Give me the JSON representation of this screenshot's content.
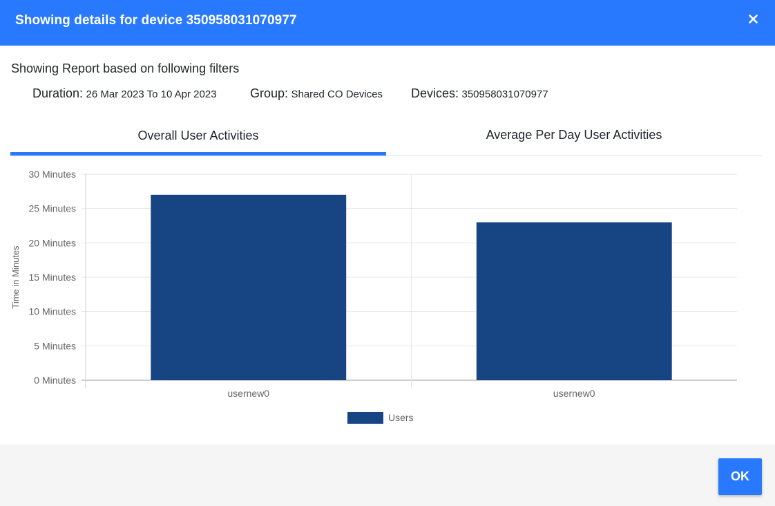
{
  "dialog": {
    "title": "Showing details for device 350958031070977",
    "close_icon": "close-icon"
  },
  "filters": {
    "heading": "Showing Report based on following filters",
    "duration_label": "Duration:",
    "duration_value": "26 Mar 2023 To 10 Apr 2023",
    "group_label": "Group:",
    "group_value": "Shared CO Devices",
    "devices_label": "Devices:",
    "devices_value": "350958031070977"
  },
  "tabs": [
    {
      "label": "Overall User Activities",
      "active": true
    },
    {
      "label": "Average Per Day User Activities",
      "active": false
    }
  ],
  "colors": {
    "accent": "#2979ff",
    "bar": "#174584"
  },
  "chart_data": {
    "type": "bar",
    "categories": [
      "usernew0",
      "usernew0"
    ],
    "series": [
      {
        "name": "Users",
        "values": [
          27,
          23
        ],
        "color": "#174584"
      }
    ],
    "ylabel": "Time in Minutes",
    "ylim": [
      0,
      30
    ],
    "yticks": [
      0,
      5,
      10,
      15,
      20,
      25,
      30
    ],
    "ytick_suffix": " Minutes",
    "grid": true,
    "legend": "bottom-center"
  },
  "footer": {
    "ok_label": "OK"
  }
}
